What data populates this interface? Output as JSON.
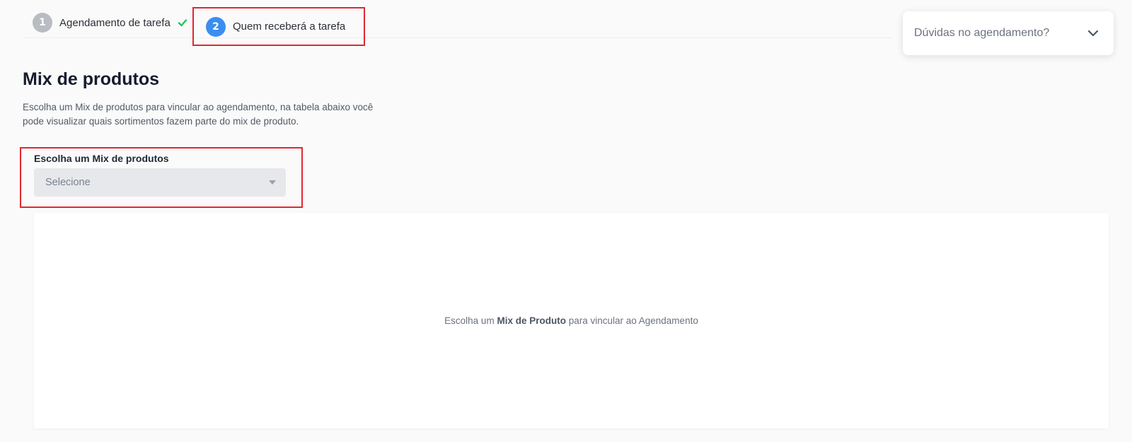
{
  "stepper": {
    "steps": [
      {
        "number": "1",
        "label": "Agendamento de tarefa",
        "status": "completed"
      },
      {
        "number": "2",
        "label": "Quem receberá a tarefa",
        "status": "active"
      }
    ]
  },
  "help": {
    "label": "Dúvidas no agendamento?",
    "icon": "chevron-down-icon"
  },
  "section": {
    "title": "Mix de produtos",
    "description": "Escolha um Mix de produtos para vincular ao agendamento, na tabela abaixo você pode visualizar quais sortimentos fazem parte do mix de produto."
  },
  "mix_select": {
    "label": "Escolha um Mix de produtos",
    "value": "Selecione"
  },
  "empty_state": {
    "prefix": "Escolha um ",
    "highlight": "Mix de Produto",
    "suffix": " para vincular ao Agendamento"
  },
  "colors": {
    "accent": "#3b8ef0",
    "success": "#22c55e",
    "highlight_border": "#e0282e",
    "step_inactive": "#b9bcc2"
  }
}
